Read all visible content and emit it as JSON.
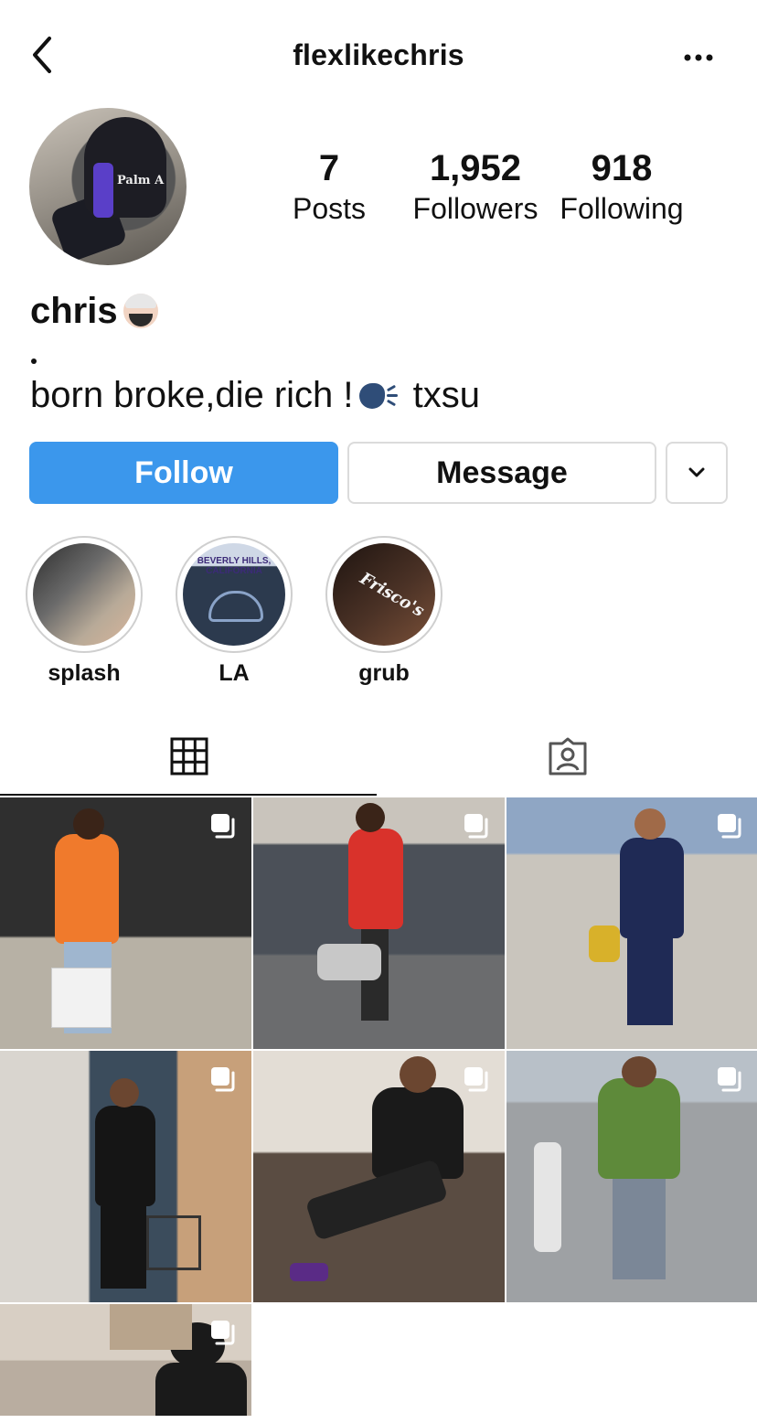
{
  "header": {
    "username": "flexlikechris"
  },
  "stats": {
    "posts_count": "7",
    "posts_label": "Posts",
    "followers_count": "1,952",
    "followers_label": "Followers",
    "following_count": "918",
    "following_label": "Following"
  },
  "profile": {
    "name": "chris",
    "bio_prefix": "born broke,die rich !",
    "bio_suffix": " txsu"
  },
  "actions": {
    "follow_label": "Follow",
    "message_label": "Message"
  },
  "highlights": [
    {
      "label": "splash"
    },
    {
      "label": "LA",
      "sign_text": "BEVERLY HILLS, CALIFORNIA"
    },
    {
      "label": "grub",
      "logo_text": "Frisco's"
    }
  ],
  "tabs": [
    {
      "icon": "grid-icon",
      "active": true
    },
    {
      "icon": "tagged-icon",
      "active": false
    }
  ],
  "posts": [
    {
      "id": 1,
      "multiple": true
    },
    {
      "id": 2,
      "multiple": true
    },
    {
      "id": 3,
      "multiple": true
    },
    {
      "id": 4,
      "multiple": true
    },
    {
      "id": 5,
      "multiple": true
    },
    {
      "id": 6,
      "multiple": true
    },
    {
      "id": 7,
      "multiple": true
    }
  ],
  "colors": {
    "follow_button": "#3b97ec",
    "border": "#dbdbdb"
  }
}
